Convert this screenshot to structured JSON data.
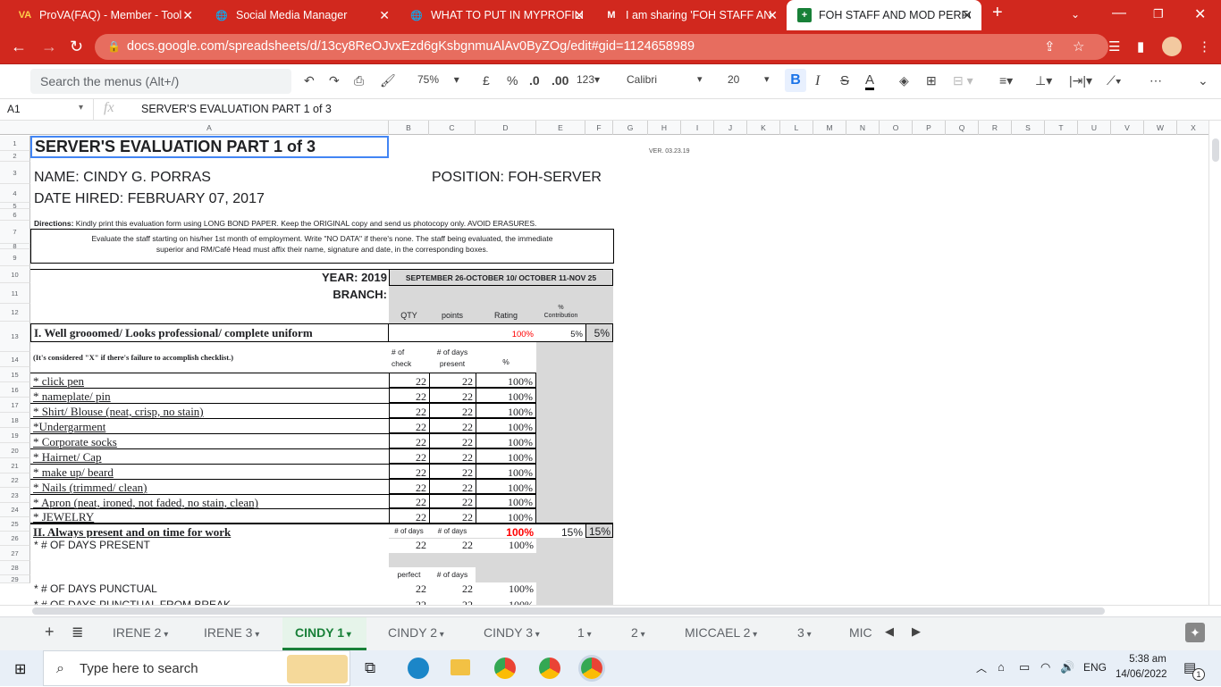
{
  "browser": {
    "tabs": [
      {
        "label": "ProVA(FAQ) - Member - Tool",
        "icon": "VA"
      },
      {
        "label": "Social Media Manager",
        "icon": "globe-icon"
      },
      {
        "label": "WHAT TO PUT IN MYPROFILE",
        "icon": "globe-icon"
      },
      {
        "label": "I am sharing 'FOH STAFF AN",
        "icon": "M"
      },
      {
        "label": "FOH STAFF AND MOD PERFO",
        "icon": "sheets-icon"
      }
    ],
    "url": "docs.google.com/spreadsheets/d/13cy8ReOJvxEzd6gKsbgnmuAlAv0ByZOg/edit#gid=1124658989"
  },
  "toolbar": {
    "search_placeholder": "Search the menus (Alt+/)",
    "zoom": "75%",
    "currency": "£",
    "percent": "%",
    "dec_less": ".0",
    "dec_more": ".00",
    "format": "123",
    "font": "Calibri",
    "font_size": "20",
    "bold": "B",
    "italic": "I",
    "strike": "S",
    "color_a": "A"
  },
  "formula_bar": {
    "cell_ref": "A1",
    "fx": "fx",
    "content": "SERVER'S EVALUATION PART 1 of 3"
  },
  "columns": [
    "A",
    "B",
    "C",
    "D",
    "E",
    "F",
    "G",
    "H",
    "I",
    "J",
    "K",
    "L",
    "M",
    "N",
    "O",
    "P",
    "Q",
    "R",
    "S",
    "T",
    "U",
    "V",
    "W",
    "X"
  ],
  "rows": [
    "1",
    "2",
    "3",
    "4",
    "5",
    "6",
    "7",
    "8",
    "9",
    "10",
    "11",
    "12",
    "13",
    "14",
    "15",
    "16",
    "17",
    "18",
    "19",
    "20",
    "21",
    "22",
    "23",
    "24",
    "25",
    "26",
    "27",
    "28",
    "29"
  ],
  "sheet": {
    "title": "SERVER'S EVALUATION PART 1 of 3",
    "version": "VER. 03.23.19",
    "name": "NAME: CINDY G. PORRAS",
    "position": "POSITION: FOH-SERVER",
    "date_hired": "DATE HIRED: FEBRUARY 07, 2017",
    "directions_label": "Directions:",
    "directions": " Kindly print this evaluation form using LONG BOND PAPER. Keep the ORIGINAL copy and send us photocopy only. AVOID ERASURES.",
    "instructions_1": "Evaluate the staff starting on his/her  1st month of employment.  Write \"NO DATA\" if there's none.  The staff being evaluated, the immediate",
    "instructions_2": "superior and RM/Café Head must affix their name, signature and date, in the corresponding boxes.",
    "year_label": "YEAR: 2019",
    "period": "SEPTEMBER 26-OCTOBER 10/ OCTOBER 11-NOV 25",
    "branch_label": "BRANCH:",
    "hdr_qty": "QTY",
    "hdr_points": "points",
    "hdr_rating": "Rating",
    "hdr_pct_top": "%",
    "hdr_pct_bottom": "Contribution",
    "sec1_title": "I. Well grooomed/ Looks professional/ complete uniform",
    "sec1_rating": "100%",
    "sec1_e": "5%",
    "sec1_f": "5%",
    "sec1_note": "(It's considered \"X\" if there's failure to accomplish checklist.)",
    "sec1_b13a": "# of",
    "sec1_b13b": "check",
    "sec1_c13a": "# of days",
    "sec1_c13b": "present",
    "sec1_d13": "%",
    "items": [
      {
        "label": "* click pen",
        "qty": "22",
        "points": "22",
        "rating": "100%"
      },
      {
        "label": "* nameplate/ pin",
        "qty": "22",
        "points": "22",
        "rating": "100%"
      },
      {
        "label": "* Shirt/ Blouse (neat, crisp, no stain)",
        "qty": "22",
        "points": "22",
        "rating": "100%"
      },
      {
        "label": "*Undergarment",
        "qty": "22",
        "points": "22",
        "rating": "100%"
      },
      {
        "label": "* Corporate socks",
        "qty": "22",
        "points": "22",
        "rating": "100%"
      },
      {
        "label": "* Hairnet/ Cap",
        "qty": "22",
        "points": "22",
        "rating": "100%"
      },
      {
        "label": "* make up/ beard",
        "qty": "22",
        "points": "22",
        "rating": "100%"
      },
      {
        "label": "* Nails (trimmed/ clean)",
        "qty": "22",
        "points": "22",
        "rating": "100%"
      },
      {
        "label": "* Apron (neat, ironed, not faded, no stain, clean)",
        "qty": "22",
        "points": "22",
        "rating": "100%"
      },
      {
        "label": "* JEWELRY",
        "qty": "22",
        "points": "22",
        "rating": "100%"
      }
    ],
    "sec2_title": "II. Always present and on time for work",
    "sec2_b": "# of days",
    "sec2_c": "# of days",
    "sec2_rating": "100%",
    "sec2_e": "15%",
    "sec2_f": "15%",
    "row25_label": "* # OF DAYS PRESENT",
    "row25_b": "22",
    "row25_c": "22",
    "row25_d": "100%",
    "row27_b": "perfect",
    "row27_c": "# of days",
    "row28_label": "* # OF DAYS PUNCTUAL",
    "row28_b": "22",
    "row28_c": "22",
    "row28_d": "100%",
    "row29_label": "* # OF DAYS PUNCTUAL FROM BREAK",
    "row29_b": "22",
    "row29_c": "22",
    "row29_d": "100%"
  },
  "sheet_tabs": [
    "IRENE 2",
    "IRENE 3",
    "CINDY 1",
    "CINDY 2",
    "CINDY 3",
    "1",
    "2",
    "MICCAEL 2",
    "3",
    "MIC"
  ],
  "taskbar": {
    "search_placeholder": "Type here to search",
    "lang": "ENG",
    "time": "5:38 am",
    "date": "14/06/2022",
    "notif_count": "1"
  },
  "colors": {
    "brand_red": "#d1281e",
    "sheets_green": "#188038",
    "red_text": "#ff0000"
  }
}
